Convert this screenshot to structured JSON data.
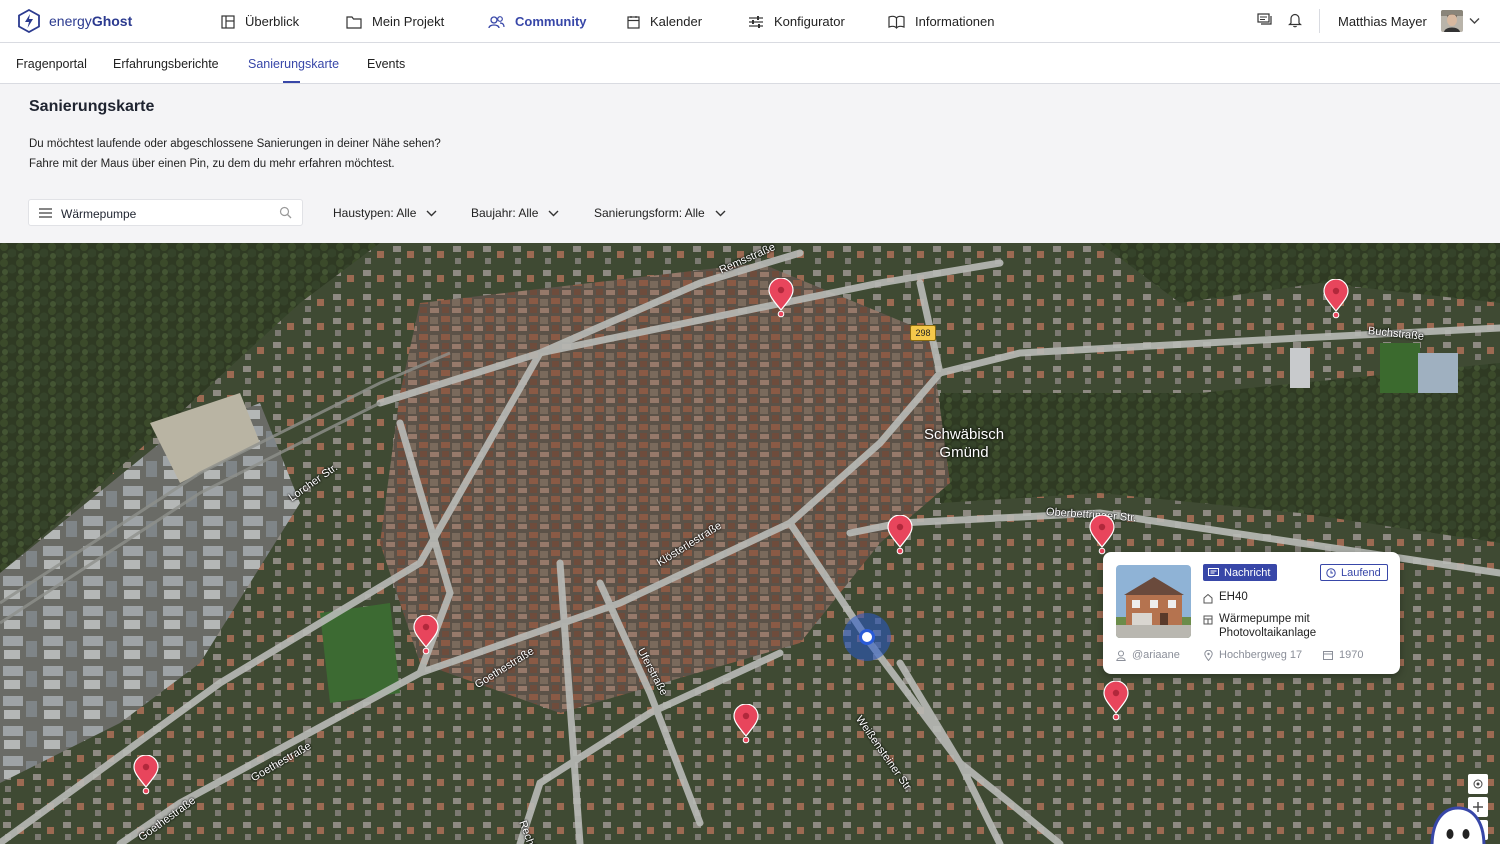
{
  "app": {
    "brand_prefix": "energy",
    "brand_suffix": "Ghost"
  },
  "topnav": {
    "items": [
      {
        "label": "Überblick",
        "icon": "layout-icon"
      },
      {
        "label": "Mein Projekt",
        "icon": "folder-icon"
      },
      {
        "label": "Community",
        "icon": "community-icon",
        "active": true
      },
      {
        "label": "Kalender",
        "icon": "calendar-icon"
      },
      {
        "label": "Konfigurator",
        "icon": "sliders-icon"
      },
      {
        "label": "Informationen",
        "icon": "book-icon"
      }
    ],
    "user_name": "Matthias Mayer"
  },
  "subnav": {
    "items": [
      {
        "label": "Fragenportal"
      },
      {
        "label": "Erfahrungsberichte"
      },
      {
        "label": "Sanierungskarte",
        "active": true
      },
      {
        "label": "Events"
      }
    ]
  },
  "page": {
    "title": "Sanierungskarte",
    "desc_line1": "Du möchtest laufende oder abgeschlossene Sanierungen in deiner Nähe sehen?",
    "desc_line2": "Fahre mit der Maus über einen Pin, zu dem du mehr erfahren möchtest."
  },
  "filters": {
    "search_value": "Wärmepumpe",
    "haustypen": "Haustypen: Alle",
    "baujahr": "Baujahr: Alle",
    "sanierungsform": "Sanierungsform: Alle"
  },
  "map": {
    "city_line1": "Schwäbisch",
    "city_line2": "Gmünd",
    "road_number": "298",
    "streets": {
      "remsstrasse": "Remsstraße",
      "buchstrasse": "Buchstraße",
      "lorcher": "Lorcher Str.",
      "klosterle": "Klösterlestraße",
      "oberbettringer": "Oberbettringer Str.",
      "goethe1": "Goethestraße",
      "goethe2": "Goethestraße",
      "goethe3": "Goethestraße",
      "ufer": "Uferstraße",
      "weissenstein": "Weißensteiner Str.",
      "rech": "Rechb"
    },
    "accent": "#e8455c"
  },
  "card": {
    "badge_type": "Nachricht",
    "badge_status": "Laufend",
    "standard": "EH40",
    "measure_line1": "Wärmepumpe mit",
    "measure_line2": "Photovoltaikanlage",
    "user": "@ariaane",
    "address": "Hochbergweg 17",
    "year": "1970"
  },
  "colors": {
    "primary": "#3847a8",
    "pin": "#e8455c"
  }
}
